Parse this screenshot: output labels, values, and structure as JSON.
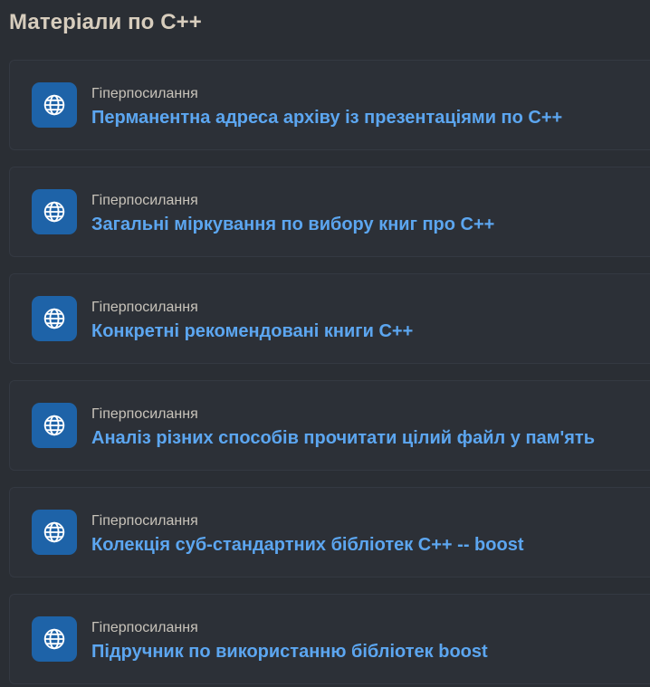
{
  "section": {
    "title": "Матеріали по C++"
  },
  "colors": {
    "background": "#2a2e34",
    "title": "#d7cdbd",
    "link": "#5ca6f0",
    "icon_tile": "#1e63a8"
  },
  "items": [
    {
      "type_label": "Гіперпосилання",
      "title": "Перманентна адреса архіву із презентаціями по C++",
      "icon": "globe-icon"
    },
    {
      "type_label": "Гіперпосилання",
      "title": "Загальні міркування по вибору книг про C++",
      "icon": "globe-icon"
    },
    {
      "type_label": "Гіперпосилання",
      "title": "Конкретні рекомендовані книги C++",
      "icon": "globe-icon"
    },
    {
      "type_label": "Гіперпосилання",
      "title": "Аналіз різних способів прочитати цілий файл у пам'ять",
      "icon": "globe-icon"
    },
    {
      "type_label": "Гіперпосилання",
      "title": "Колекція суб-стандартних бібліотек C++ -- boost",
      "icon": "globe-icon"
    },
    {
      "type_label": "Гіперпосилання",
      "title": "Підручник по використанню бібліотек boost",
      "icon": "globe-icon"
    }
  ]
}
